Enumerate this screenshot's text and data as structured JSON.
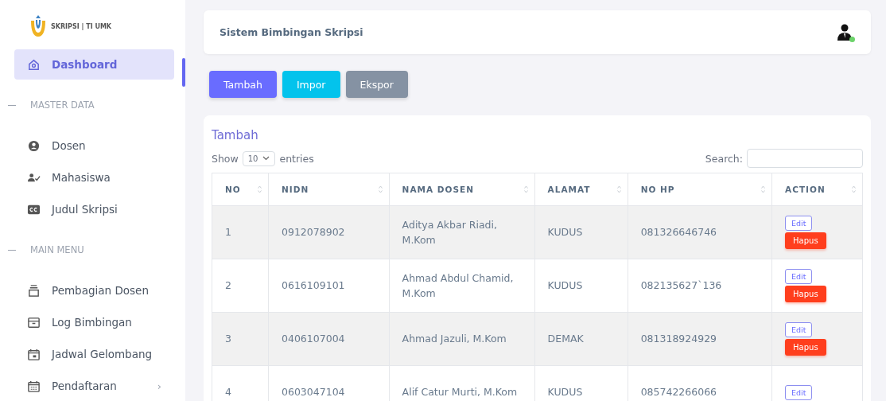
{
  "brand": {
    "text": "SKRIPSI | TI UMK"
  },
  "sidebar": [
    {
      "kind": "item",
      "label": "Dashboard",
      "selected": true
    },
    {
      "kind": "heading",
      "label": "MASTER DATA"
    },
    {
      "kind": "item",
      "label": "Dosen",
      "selected": false
    },
    {
      "kind": "item",
      "label": "Mahasiswa",
      "selected": false
    },
    {
      "kind": "item",
      "label": "Judul Skripsi",
      "selected": false
    },
    {
      "kind": "heading",
      "label": "MAIN MENU"
    },
    {
      "kind": "item",
      "label": "Pembagian Dosen",
      "selected": false
    },
    {
      "kind": "item",
      "label": "Log Bimbingan",
      "selected": false
    },
    {
      "kind": "item",
      "label": "Jadwal Gelombang",
      "selected": false
    },
    {
      "kind": "item",
      "label": "Pendaftaran",
      "selected": false,
      "chevron": "›"
    }
  ],
  "header": {
    "title": "Sistem Bimbingan Skripsi",
    "user_online": true
  },
  "toolbar": [
    {
      "label": "Tambah",
      "kind": "primary"
    },
    {
      "label": "Impor",
      "kind": "info"
    },
    {
      "label": "Ekspor",
      "kind": "secondary"
    }
  ],
  "card": {
    "title": "Tambah",
    "show_label": "Show",
    "page_size": "10",
    "entries_label": "entries",
    "search_label": "Search:"
  },
  "table": {
    "columns": [
      "NO",
      "NIDN",
      "NAMA DOSEN",
      "ALAMAT",
      "NO HP",
      "ACTION"
    ],
    "rows": [
      {
        "cells": [
          "1",
          "0912078902",
          "Aditya Akbar Riadi, M.Kom",
          "KUDUS",
          "081326646746"
        ],
        "actions": [
          {
            "kind": "edit",
            "label": "Edit"
          },
          {
            "kind": "delete",
            "label": "Hapus"
          }
        ]
      },
      {
        "cells": [
          "2",
          "0616109101",
          "Ahmad Abdul Chamid, M.Kom",
          "KUDUS",
          "082135627`136"
        ],
        "actions": [
          {
            "kind": "edit",
            "label": "Edit"
          },
          {
            "kind": "delete",
            "label": "Hapus"
          }
        ]
      },
      {
        "cells": [
          "3",
          "0406107004",
          "Ahmad Jazuli, M.Kom",
          "DEMAK",
          "081318924929"
        ],
        "actions": [
          {
            "kind": "edit",
            "label": "Edit"
          },
          {
            "kind": "delete",
            "label": "Hapus"
          }
        ]
      },
      {
        "cells": [
          "4",
          "0603047104",
          "Alif Catur Murti, M.Kom",
          "KUDUS",
          "085742266066"
        ],
        "actions": [
          {
            "kind": "edit",
            "label": "Edit"
          }
        ]
      }
    ]
  }
}
